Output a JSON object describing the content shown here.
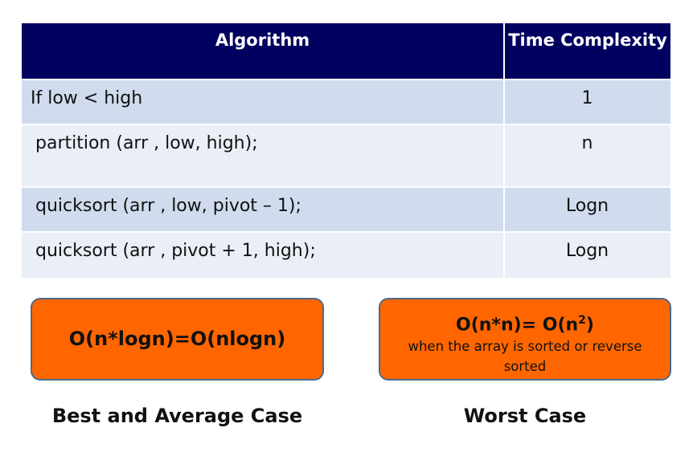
{
  "table": {
    "header": {
      "algorithm": "Algorithm",
      "time_complexity": "Time Complexity"
    },
    "rows": [
      {
        "code": "If low < high",
        "complexity": "1"
      },
      {
        "code": "partition (arr , low, high);",
        "complexity": "n"
      },
      {
        "code": "quicksort (arr , low, pivot – 1);",
        "complexity": "Logn"
      },
      {
        "code": "quicksort (arr , pivot + 1, high);",
        "complexity": "Logn"
      }
    ]
  },
  "best_case": {
    "formula": "O(n*logn)=O(nlogn)",
    "caption": "Best and Average Case"
  },
  "worst_case": {
    "formula_prefix": "O(n*n)= O(n",
    "formula_sup": "2",
    "formula_suffix": ")",
    "note": "when the array is sorted or reverse sorted",
    "caption": "Worst Case"
  },
  "colors": {
    "header_bg": "#010160",
    "row_dark": "#d0dced",
    "row_light": "#e9eef7",
    "box_fill": "#ff6600",
    "box_border": "#4a6a8a"
  }
}
